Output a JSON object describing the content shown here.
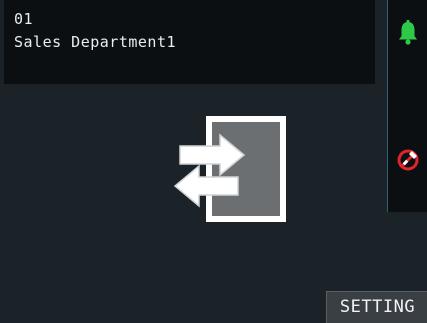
{
  "info": {
    "id": "01",
    "name": "Sales Department1"
  },
  "status_icons": {
    "top": "bell-icon",
    "bottom": "no-entry-icon"
  },
  "center_icon": "door-exit-icon",
  "colors": {
    "background": "#1c2328",
    "panel": "#0b0f12",
    "bell": "#2fc94a",
    "no_entry": "#e0242b",
    "door": "#6b6f72"
  },
  "buttons": {
    "setting_label": "SETTING"
  }
}
